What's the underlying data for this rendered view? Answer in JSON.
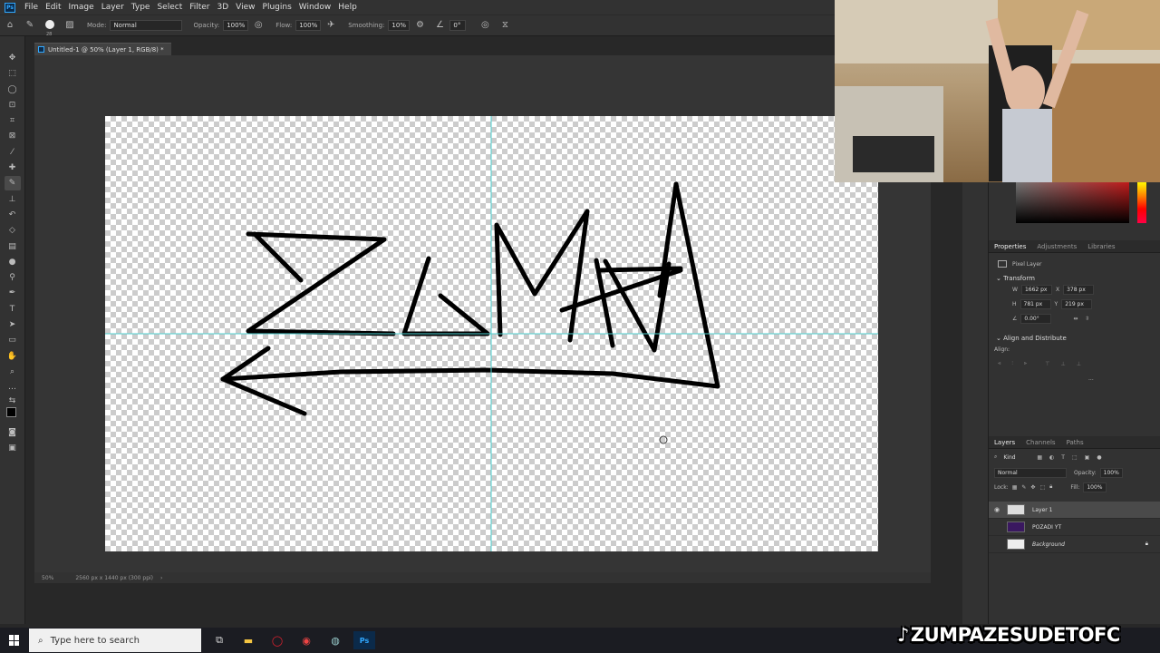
{
  "app": {
    "logo": "Ps",
    "menu": [
      "File",
      "Edit",
      "Image",
      "Layer",
      "Type",
      "Select",
      "Filter",
      "3D",
      "View",
      "Plugins",
      "Window",
      "Help"
    ]
  },
  "options_bar": {
    "brush_size": "28",
    "mode_label": "Mode:",
    "mode_value": "Normal",
    "opacity_label": "Opacity:",
    "opacity_value": "100%",
    "flow_label": "Flow:",
    "flow_value": "100%",
    "smoothing_label": "Smoothing:",
    "smoothing_value": "10%",
    "angle_value": "0°"
  },
  "document": {
    "tab_title": "Untitled-1 @ 50% (Layer 1, RGB/8) *",
    "zoom": "50%",
    "doc_info": "2560 px x 1440 px (300 ppi)"
  },
  "properties": {
    "tabs": [
      "Properties",
      "Adjustments",
      "Libraries"
    ],
    "layer_type": "Pixel Layer",
    "transform_title": "Transform",
    "w_label": "W",
    "w_value": "1662 px",
    "x_label": "X",
    "x_value": "378 px",
    "h_label": "H",
    "h_value": "781 px",
    "y_label": "Y",
    "y_value": "219 px",
    "angle_value": "0.00°",
    "align_title": "Align and Distribute",
    "align_label": "Align:",
    "more": "..."
  },
  "layers": {
    "tabs": [
      "Layers",
      "Channels",
      "Paths"
    ],
    "kind_label": "Kind",
    "blend_mode": "Normal",
    "opacity_label": "Opacity:",
    "opacity_value": "100%",
    "lock_label": "Lock:",
    "fill_label": "Fill:",
    "fill_value": "100%",
    "items": [
      {
        "name": "Layer 1",
        "visible": true,
        "selected": true
      },
      {
        "name": "POZADI YT",
        "visible": false,
        "selected": false
      },
      {
        "name": "Background",
        "visible": false,
        "selected": false,
        "locked": true
      }
    ]
  },
  "taskbar": {
    "search_placeholder": "Type here to search"
  },
  "watermark": "ZUMPAZESUDETOFC",
  "colors": {
    "accent": "#31a8ff",
    "guide": "#4ed0d0"
  }
}
